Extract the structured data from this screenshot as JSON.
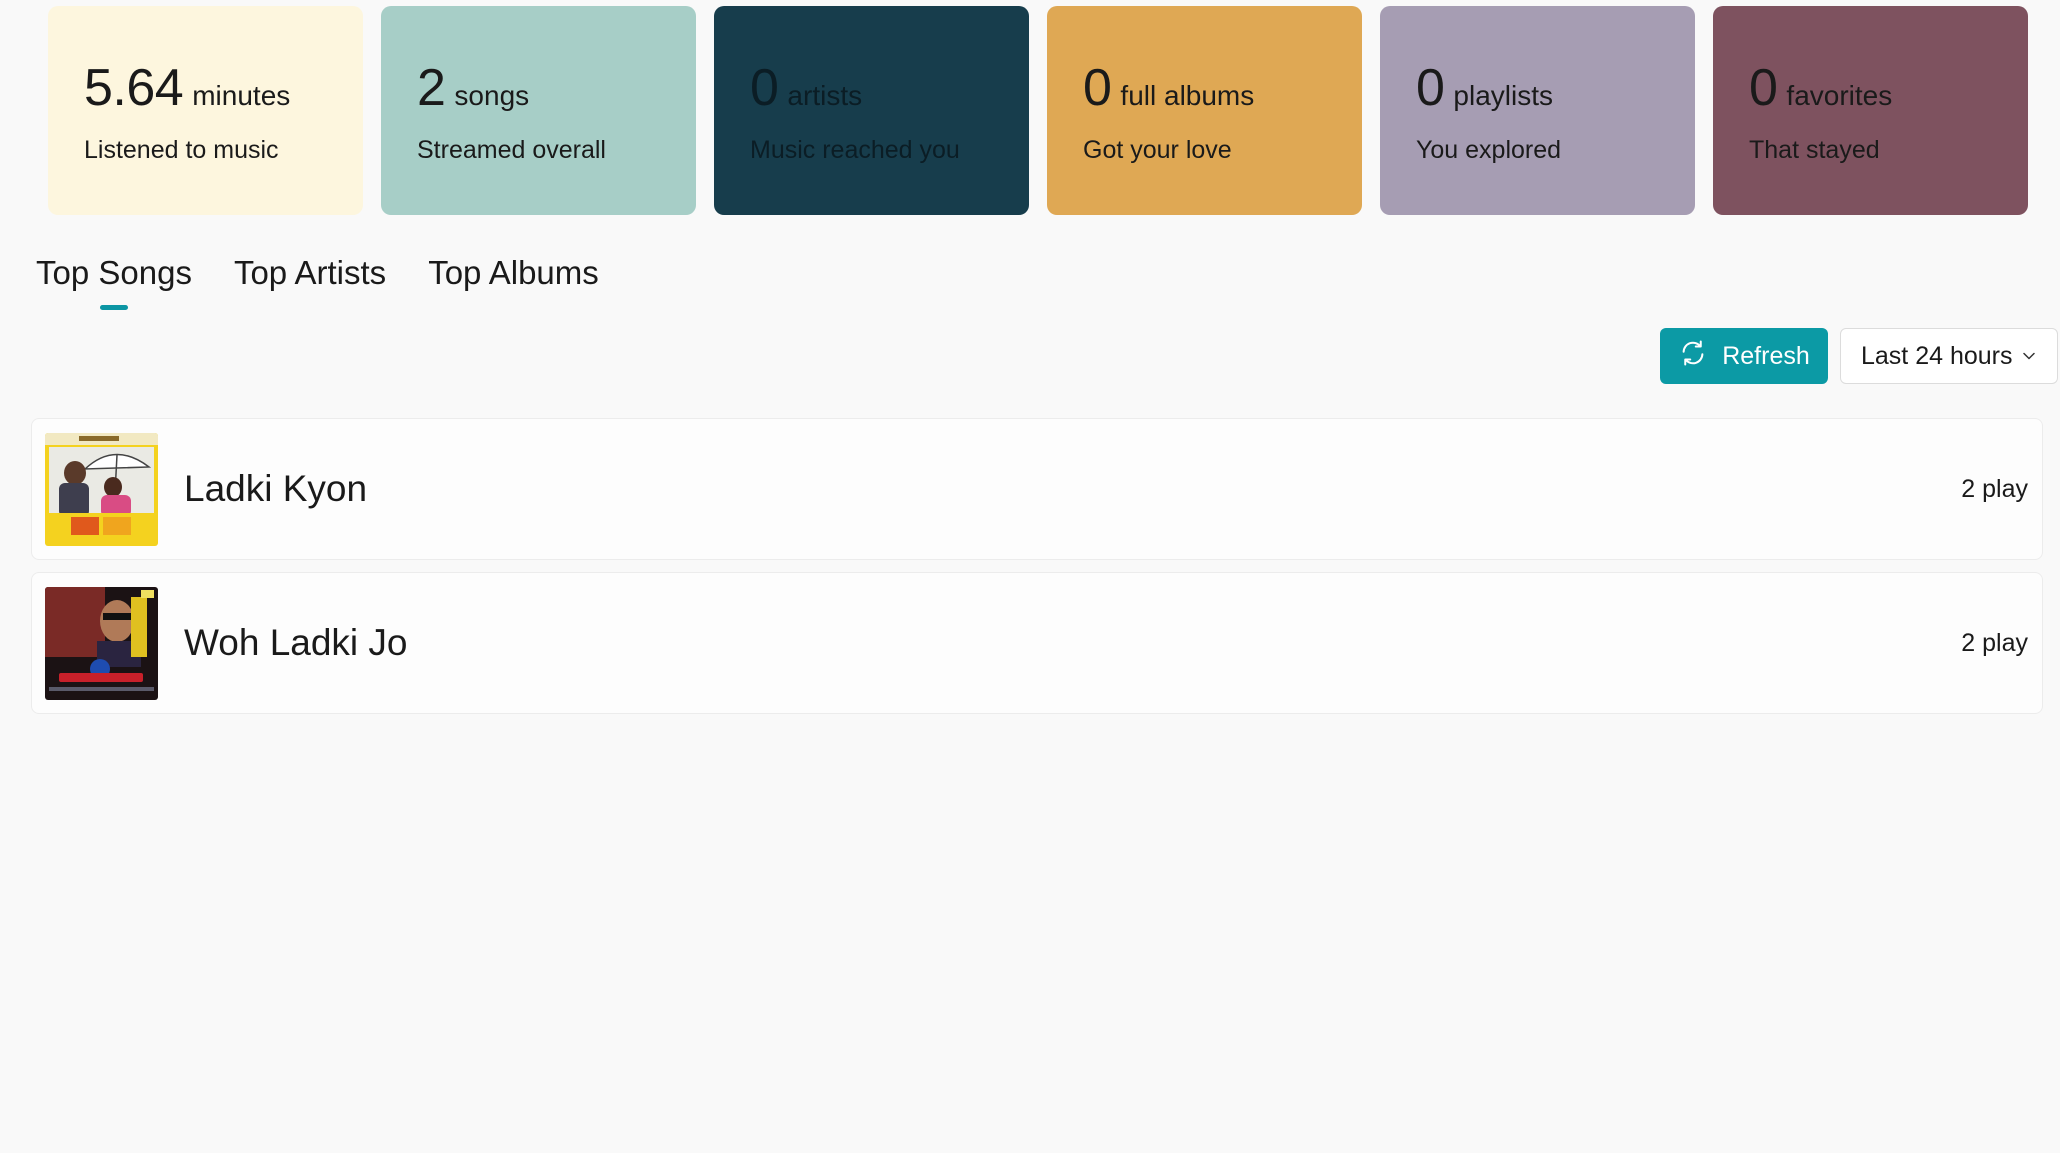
{
  "stats": [
    {
      "value": "5.64",
      "unit": "minutes",
      "caption": "Listened to music",
      "bg": "#fdf6de",
      "fg": "#1a1a1a"
    },
    {
      "value": "2",
      "unit": "songs",
      "caption": "Streamed overall",
      "bg": "#a7cec7",
      "fg": "#1a1a1a"
    },
    {
      "value": "0",
      "unit": "artists",
      "caption": "Music reached you",
      "bg": "#173d4c",
      "fg": "#0b1d25"
    },
    {
      "value": "0",
      "unit": "full albums",
      "caption": "Got your love",
      "bg": "#dfa854",
      "fg": "#1a1a1a"
    },
    {
      "value": "0",
      "unit": "playlists",
      "caption": "You explored",
      "bg": "#a69db3",
      "fg": "#1a1a1a"
    },
    {
      "value": "0",
      "unit": "favorites",
      "caption": "That stayed",
      "bg": "#7e525f",
      "fg": "#1a1a1a"
    }
  ],
  "tabs": [
    {
      "label": "Top Songs",
      "active": true
    },
    {
      "label": "Top Artists",
      "active": false
    },
    {
      "label": "Top Albums",
      "active": false
    }
  ],
  "toolbar": {
    "refresh_label": "Refresh",
    "range_selected": "Last 24 hours"
  },
  "songs": [
    {
      "title": "Ladki Kyon",
      "plays": "2 play",
      "cover_icon": "album-cover-hum-tum"
    },
    {
      "title": "Woh Ladki Jo",
      "plays": "2 play",
      "cover_icon": "album-cover-baadshah"
    }
  ],
  "colors": {
    "accent": "#0c9aa5",
    "indicator": "#0c96a4"
  }
}
